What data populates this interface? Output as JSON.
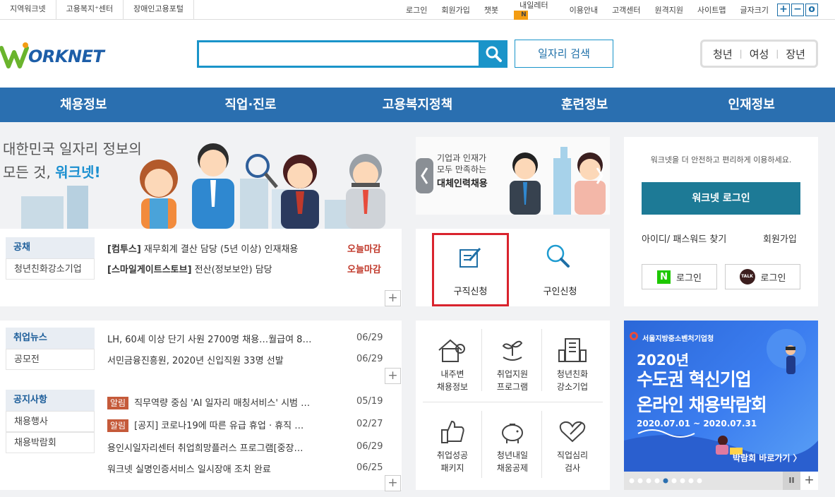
{
  "topbar": {
    "left": [
      "지역워크넷",
      "고용복지⁺센터",
      "장애인고용포털"
    ],
    "right": [
      "로그인",
      "회원가입",
      "챗봇",
      "내일레터",
      "이용안내",
      "고객센터",
      "원격지원",
      "사이트맵",
      "글자크기"
    ],
    "new_badge": "N",
    "font_buttons": [
      "+",
      "−",
      "o"
    ]
  },
  "header": {
    "logo_text": "ORKNET",
    "search_placeholder": "",
    "job_search_label": "일자리 검색",
    "audience_tabs": [
      "청년",
      "여성",
      "장년"
    ]
  },
  "gnb": [
    "채용정보",
    "직업·진로",
    "고용복지정책",
    "훈련정보",
    "인재정보"
  ],
  "hero": {
    "line1": "대한민국 일자리 정보의",
    "line2_prefix": "모든 것, ",
    "line2_brand": "워크넷!"
  },
  "recruit": {
    "tabs": [
      "공채",
      "청년친화강소기업"
    ],
    "items": [
      {
        "company": "[컴투스]",
        "title": "재무회계 결산 담당 (5년 이상) 인재채용",
        "status": "오늘마감"
      },
      {
        "company": "[스마일게이트스토브]",
        "title": "전산(정보보안) 담당",
        "status": "오늘마감"
      }
    ]
  },
  "promo": {
    "line1": "기업과 인재가",
    "line2": "모두 만족하는",
    "line3": "대체인력채용"
  },
  "apply": {
    "job_seek": "구직신청",
    "recruit": "구인신청"
  },
  "login_panel": {
    "notice": "워크넷을 더 안전하고 편리하게 이용하세요.",
    "login_button": "워크넷 로그인",
    "find_id": "아이디/ 패스워드 찾기",
    "signup": "회원가입",
    "naver_login": "로그인",
    "kakao_login": "로그인",
    "naver_icon": "N",
    "kakao_icon": "TALK"
  },
  "news": {
    "tabs": [
      "취업뉴스",
      "공모전"
    ],
    "items": [
      {
        "title": "LH, 60세 이상 단기 사원 2700명 채용…월급여 8…",
        "date": "06/29"
      },
      {
        "title": "서민금융진흥원, 2020년 신입직원 33명 선발",
        "date": "06/29"
      }
    ]
  },
  "notice": {
    "tabs": [
      "공지사항",
      "채용행사",
      "채용박람회"
    ],
    "alert_label": "알림",
    "items": [
      {
        "alert": true,
        "title": "직무역량 중심 'AI 일자리 매칭서비스' 시범 …",
        "date": "05/19"
      },
      {
        "alert": true,
        "title": "[공지] 코로나19에 따른 유급 휴업 · 휴직 …",
        "date": "02/27"
      },
      {
        "alert": false,
        "title": "용인시일자리센터 취업희망플러스 프로그램[중장…",
        "date": "06/29"
      },
      {
        "alert": false,
        "title": "워크넷 실명인증서비스 일시장애 조치 완료",
        "date": "06/25"
      }
    ]
  },
  "services": [
    {
      "line1": "내주변",
      "line2": "채용정보",
      "icon": "house-location-icon"
    },
    {
      "line1": "취업지원",
      "line2": "프로그램",
      "icon": "hand-plant-icon"
    },
    {
      "line1": "청년친화",
      "line2": "강소기업",
      "icon": "building-icon"
    },
    {
      "line1": "취업성공",
      "line2": "패키지",
      "icon": "thumbs-up-icon"
    },
    {
      "line1": "청년내일",
      "line2": "채움공제",
      "icon": "piggy-bank-icon"
    },
    {
      "line1": "직업심리",
      "line2": "검사",
      "icon": "heart-pen-icon"
    }
  ],
  "banner": {
    "org": "서울지방중소벤처기업청",
    "year": "2020년",
    "title1": "수도권 혁신기업",
    "title2": "온라인 채용박람회",
    "period": "2020.07.01 ~ 2020.07.31",
    "cta": "박람회 바로가기 〉",
    "pause": "II",
    "more": "+"
  },
  "more_symbol": "+",
  "colors": {
    "primary": "#2a6fb0",
    "accent": "#1a94c9",
    "deadline": "#c0392b",
    "highlight_box": "#d9232d"
  }
}
